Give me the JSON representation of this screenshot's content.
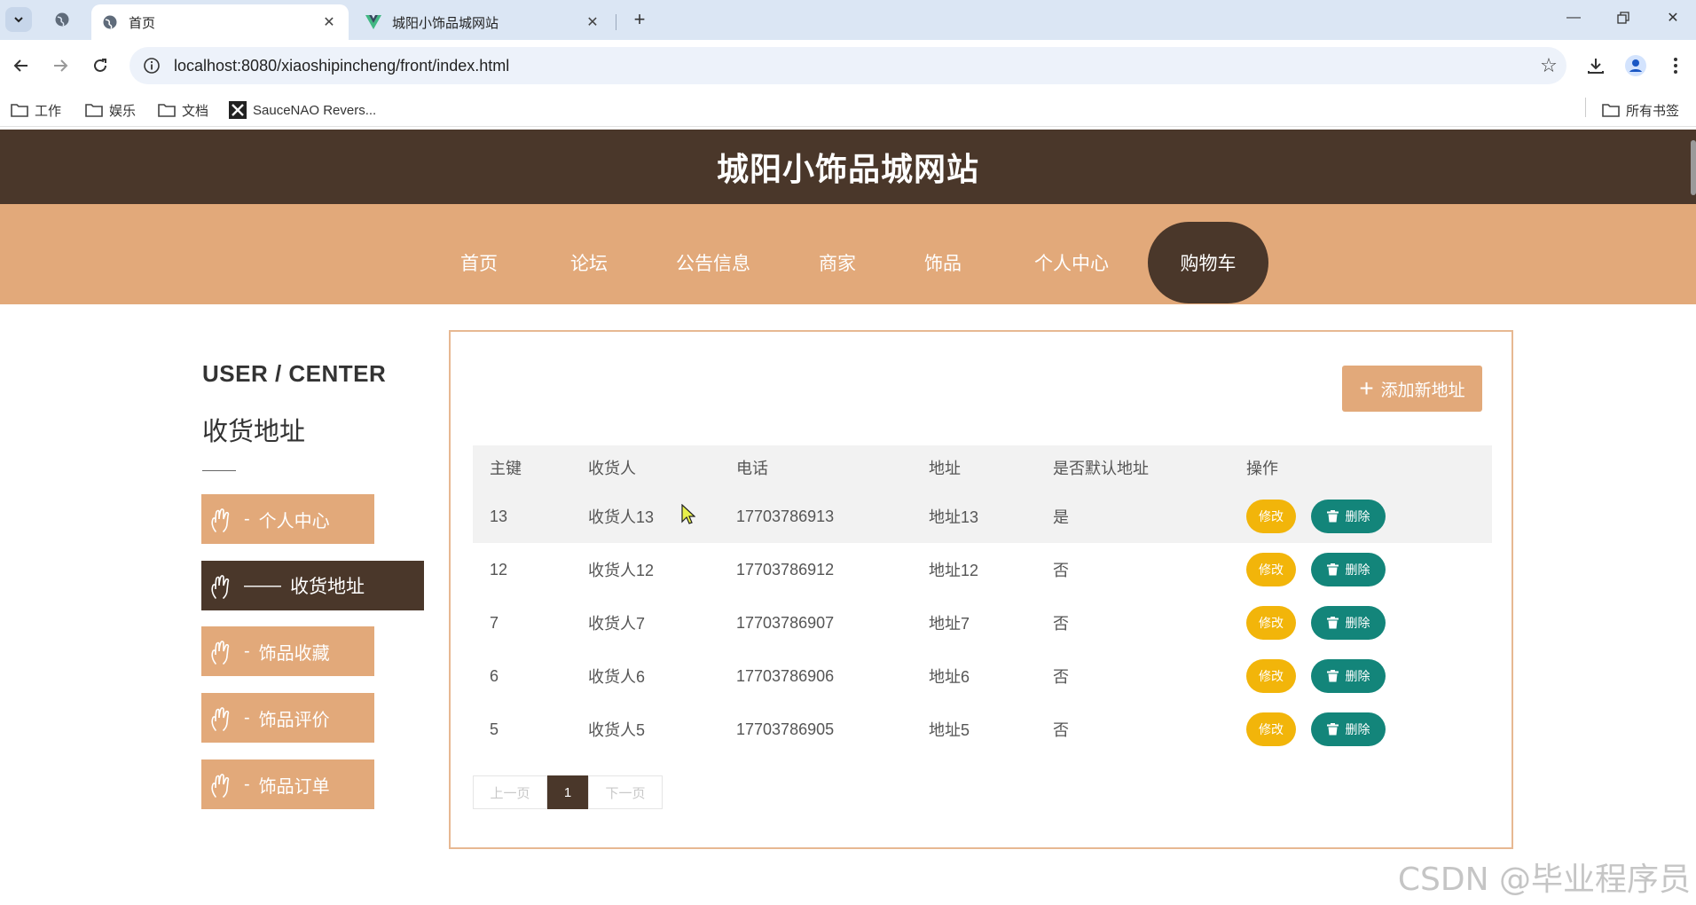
{
  "browser": {
    "tabs": [
      {
        "title": "首页",
        "icon": "globe-icon",
        "active": true
      },
      {
        "title": "城阳小饰品城网站",
        "icon": "vue-logo-icon",
        "active": false
      }
    ],
    "url": "localhost:8080/xiaoshipincheng/front/index.html",
    "bookmarks": [
      "工作",
      "娱乐",
      "文档",
      "SauceNAO Revers..."
    ],
    "all_bookmarks": "所有书签"
  },
  "site": {
    "title": "城阳小饰品城网站",
    "nav": [
      "首页",
      "论坛",
      "公告信息",
      "商家",
      "饰品",
      "个人中心",
      "购物车"
    ],
    "nav_active": "购物车",
    "accent": "#e2a97a",
    "dark": "#4a372a"
  },
  "sidebar": {
    "title": "USER / CENTER",
    "subtitle": "收货地址",
    "items": [
      {
        "label": "个人中心",
        "active": false
      },
      {
        "label": "收货地址",
        "active": true
      },
      {
        "label": "饰品收藏",
        "active": false
      },
      {
        "label": "饰品评价",
        "active": false
      },
      {
        "label": "饰品订单",
        "active": false
      }
    ]
  },
  "main": {
    "add_button": "添加新地址",
    "columns": [
      "主键",
      "收货人",
      "电话",
      "地址",
      "是否默认地址",
      "操作"
    ],
    "rows": [
      {
        "id": "13",
        "name": "收货人13",
        "phone": "17703786913",
        "address": "地址13",
        "default": "是"
      },
      {
        "id": "12",
        "name": "收货人12",
        "phone": "17703786912",
        "address": "地址12",
        "default": "否"
      },
      {
        "id": "7",
        "name": "收货人7",
        "phone": "17703786907",
        "address": "地址7",
        "default": "否"
      },
      {
        "id": "6",
        "name": "收货人6",
        "phone": "17703786906",
        "address": "地址6",
        "default": "否"
      },
      {
        "id": "5",
        "name": "收货人5",
        "phone": "17703786905",
        "address": "地址5",
        "default": "否"
      }
    ],
    "edit_label": "修改",
    "delete_label": "删除",
    "pager": {
      "prev": "上一页",
      "current": "1",
      "next": "下一页"
    }
  },
  "watermark": "CSDN @毕业程序员"
}
